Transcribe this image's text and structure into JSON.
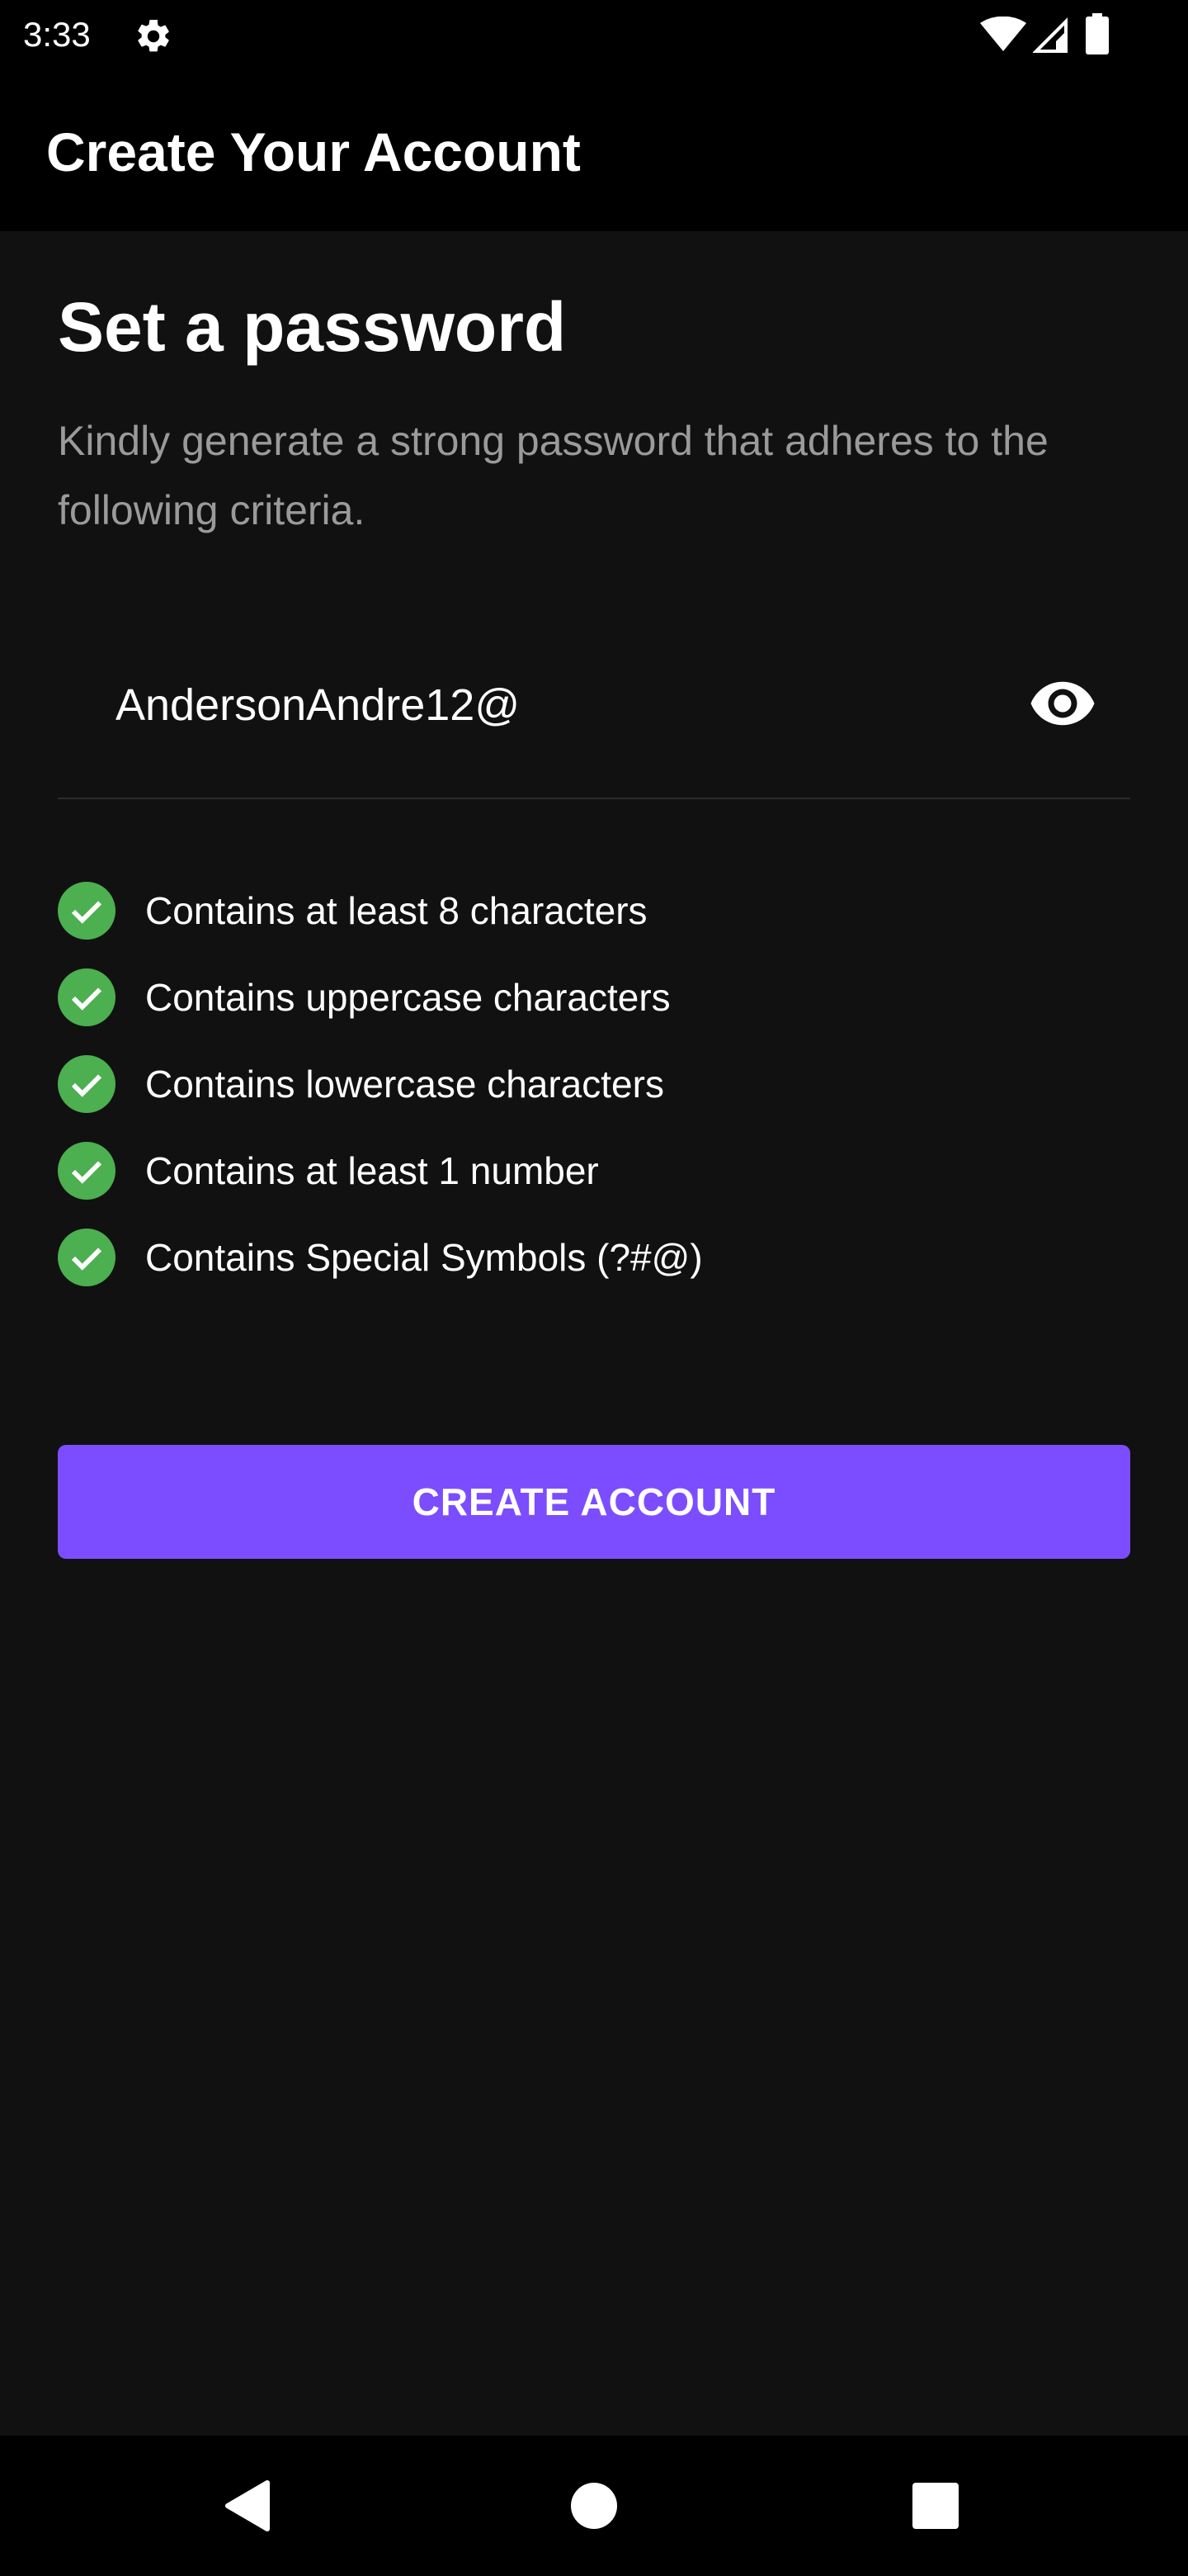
{
  "status_bar": {
    "time": "3:33",
    "icons": [
      "gear-icon",
      "wifi-icon",
      "signal-icon",
      "battery-icon"
    ]
  },
  "app_bar": {
    "title": "Create Your Account"
  },
  "main": {
    "heading": "Set a password",
    "subheading": "Kindly generate a strong password that adheres to the following criteria.",
    "password_field": {
      "value": "AndersonAndre12@",
      "toggle_icon": "eye-icon"
    },
    "criteria": [
      {
        "label": "Contains at least 8 characters",
        "met": true
      },
      {
        "label": "Contains uppercase characters",
        "met": true
      },
      {
        "label": "Contains lowercase characters",
        "met": true
      },
      {
        "label": "Contains at least 1 number",
        "met": true
      },
      {
        "label": "Contains Special Symbols (?#@)",
        "met": true
      }
    ],
    "create_button_label": "CREATE ACCOUNT"
  },
  "nav_bar": {
    "items": [
      "back-icon",
      "home-icon",
      "recents-icon"
    ]
  },
  "colors": {
    "accent": "#7c4dff",
    "check_green": "#4caf50",
    "background": "#111111",
    "bars": "#000000",
    "muted_text": "#9a9a9a"
  }
}
